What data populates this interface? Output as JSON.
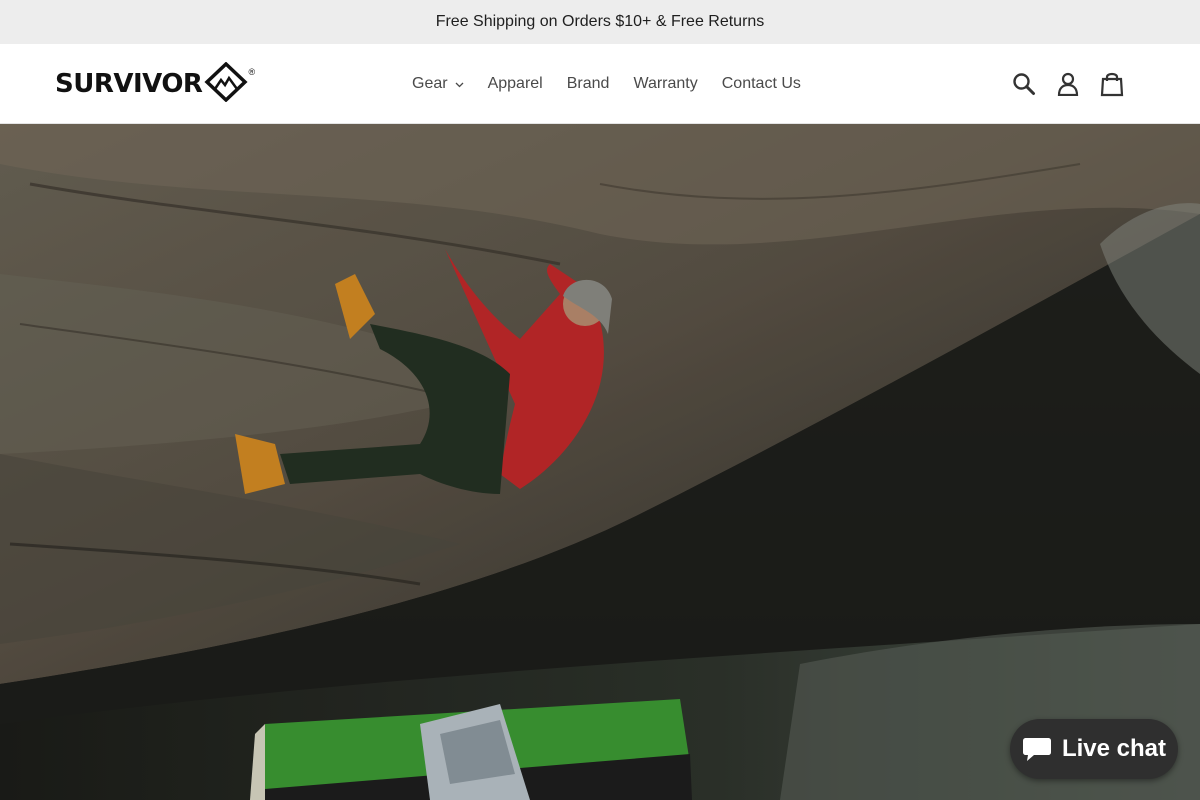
{
  "announcement": {
    "text": "Free Shipping on Orders $10+ & Free Returns"
  },
  "brand": {
    "name": "SURVIVOR",
    "registered": "®"
  },
  "nav": {
    "items": [
      {
        "label": "Gear",
        "has_dropdown": true
      },
      {
        "label": "Apparel"
      },
      {
        "label": "Brand"
      },
      {
        "label": "Warranty"
      },
      {
        "label": "Contact Us"
      }
    ]
  },
  "header_icons": [
    "search-icon",
    "account-icon",
    "cart-icon"
  ],
  "hero": {
    "image_subject": "climber on overhanging boulder above green crash pad"
  },
  "chat": {
    "label": "Live chat",
    "icon": "chat-bubble-icon",
    "bg_color": "#2f2f2f"
  },
  "colors": {
    "announcement_bg": "#ededed",
    "text": "#1f1f1f",
    "nav_text": "#4a4a4a"
  }
}
